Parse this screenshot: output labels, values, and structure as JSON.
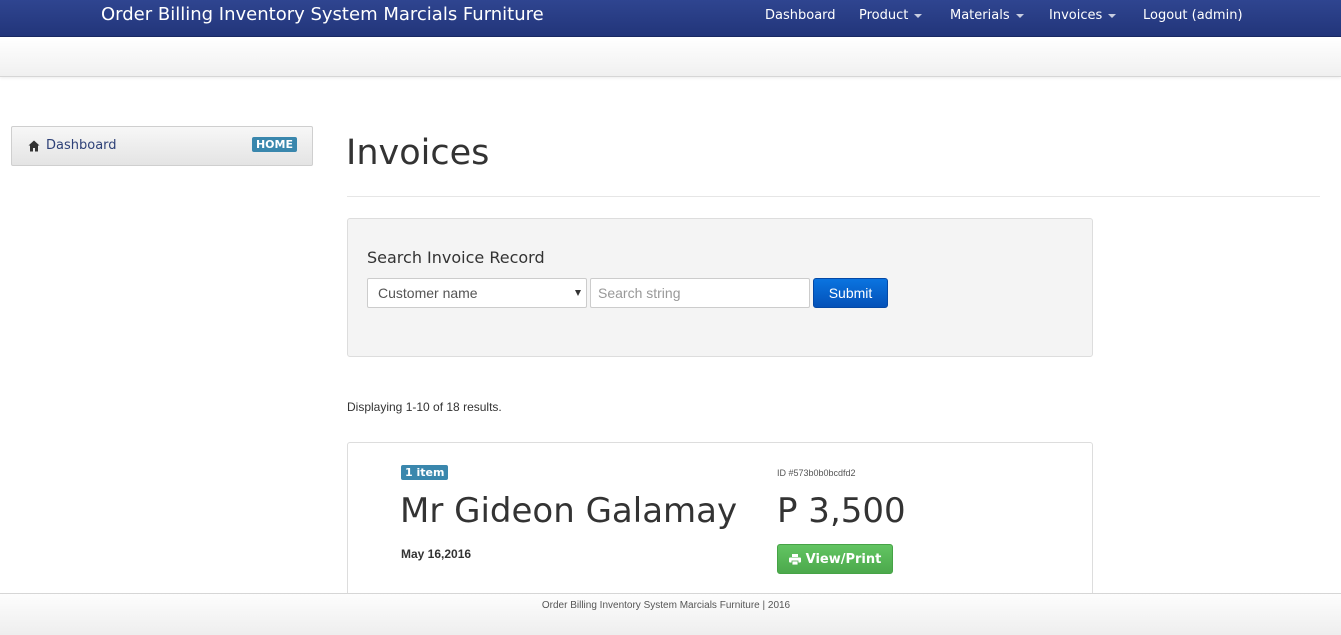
{
  "navbar": {
    "brand": "Order Billing Inventory System Marcials Furniture",
    "items": [
      {
        "label": "Dashboard",
        "dropdown": false
      },
      {
        "label": "Product",
        "dropdown": true
      },
      {
        "label": "Materials",
        "dropdown": true
      },
      {
        "label": "Invoices",
        "dropdown": true
      },
      {
        "label": "Logout (admin)",
        "dropdown": false
      }
    ]
  },
  "sidebar": {
    "items": [
      {
        "icon": "home-icon",
        "label": "Dashboard",
        "badge": "HOME"
      }
    ]
  },
  "main": {
    "title": "Invoices",
    "search": {
      "heading": "Search Invoice Record",
      "select_value": "Customer name",
      "placeholder": "Search string",
      "submit_label": "Submit"
    },
    "summary": "Displaying 1-10 of 18 results.",
    "invoices": [
      {
        "badge": "1 item",
        "customer": "Mr Gideon Galamay",
        "date": "May 16,2016",
        "id": "ID #573b0b0bcdfd2",
        "amount": "P 3,500",
        "button_label": "View/Print"
      }
    ]
  },
  "footer": {
    "text": "Order Billing Inventory System Marcials Furniture | 2016"
  },
  "colors": {
    "navbar": "#2a3f86",
    "badge": "#3a87ad",
    "submit": "#0a6fd8",
    "view_print": "#5cb85c"
  }
}
